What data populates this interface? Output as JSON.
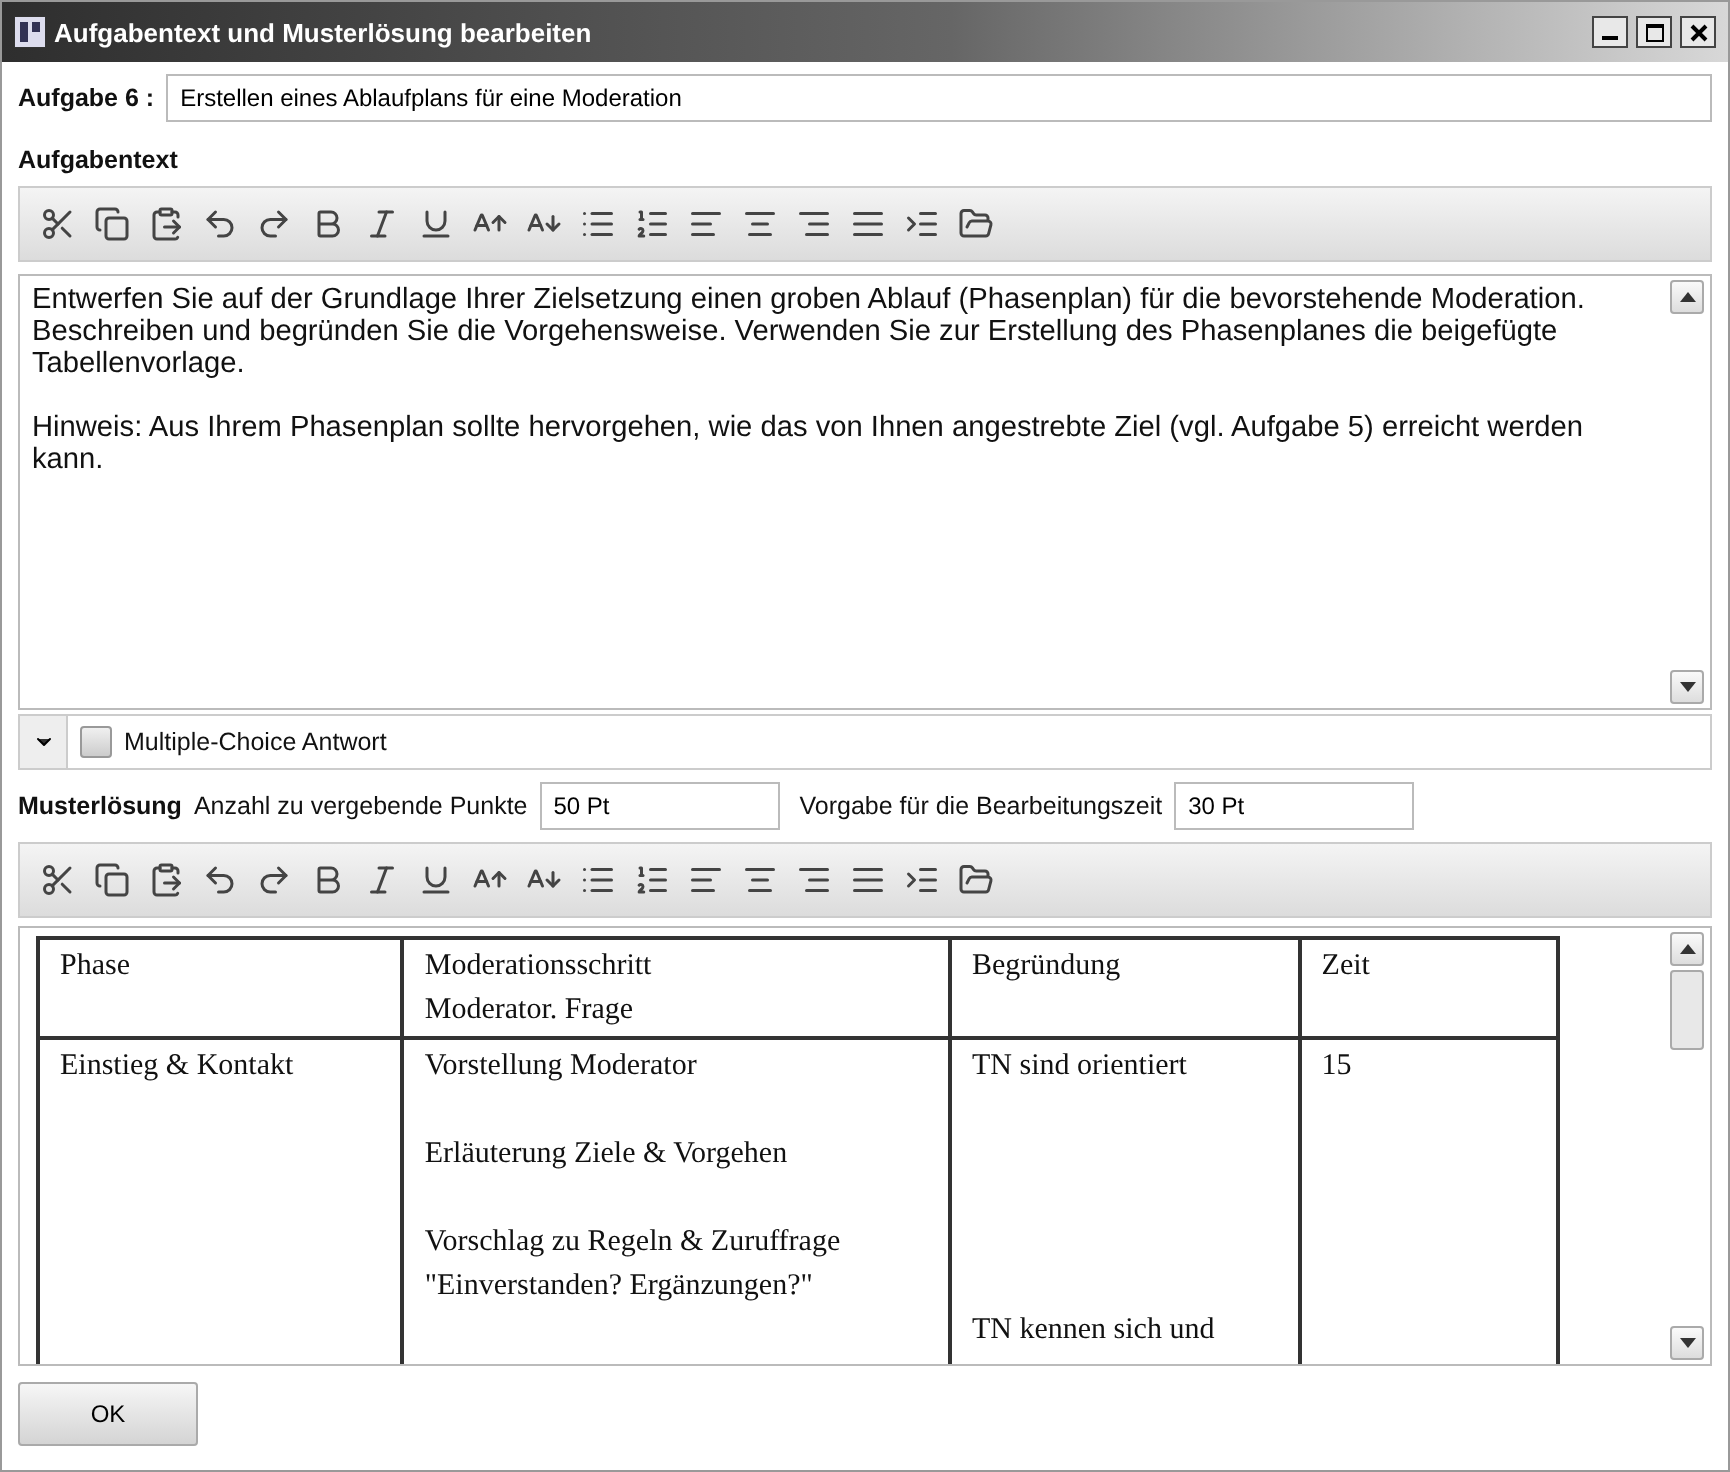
{
  "window": {
    "title": "Aufgabentext und Musterlösung bearbeiten"
  },
  "task": {
    "label": "Aufgabe 6 :",
    "value": "Erstellen eines Ablaufplans für eine Moderation"
  },
  "task_text": {
    "label": "Aufgabentext",
    "paragraphs": [
      "Entwerfen Sie auf der Grundlage Ihrer Zielsetzung einen groben Ablauf (Phasenplan) für die bevorstehende Moderation. Beschreiben und begründen Sie die Vorgehensweise. Verwenden Sie zur Erstellung des Phasenplanes die beigefügte Tabellenvorlage.",
      "Hinweis: Aus Ihrem Phasenplan sollte hervorgehen, wie das von Ihnen angestrebte Ziel (vgl. Aufgabe 5) erreicht werden kann."
    ]
  },
  "multiple_choice": {
    "label": "Multiple-Choice Antwort",
    "checked": false,
    "expanded": false
  },
  "solution": {
    "label": "Musterlösung",
    "points_label": "Anzahl zu vergebende Punkte",
    "points_value": "50 Pt",
    "time_label": "Vorgabe für die Bearbeitungszeit",
    "time_value": "30 Pt"
  },
  "table": {
    "columns": [
      "Phase",
      "Moderationsschritt\nModerator. Frage",
      "Begründung",
      "Zeit"
    ],
    "rows": [
      [
        [
          "Einstieg & Kontakt"
        ],
        [
          "Vorstellung Moderator",
          "Erläuterung Ziele & Vorgehen",
          "Vorschlag zu Regeln & Zuruffrage \"Einverstanden? Ergänzungen?\""
        ],
        [
          "TN sind orientiert",
          "TN kennen sich und"
        ],
        [
          "15"
        ]
      ]
    ]
  },
  "buttons": [
    "OK"
  ]
}
